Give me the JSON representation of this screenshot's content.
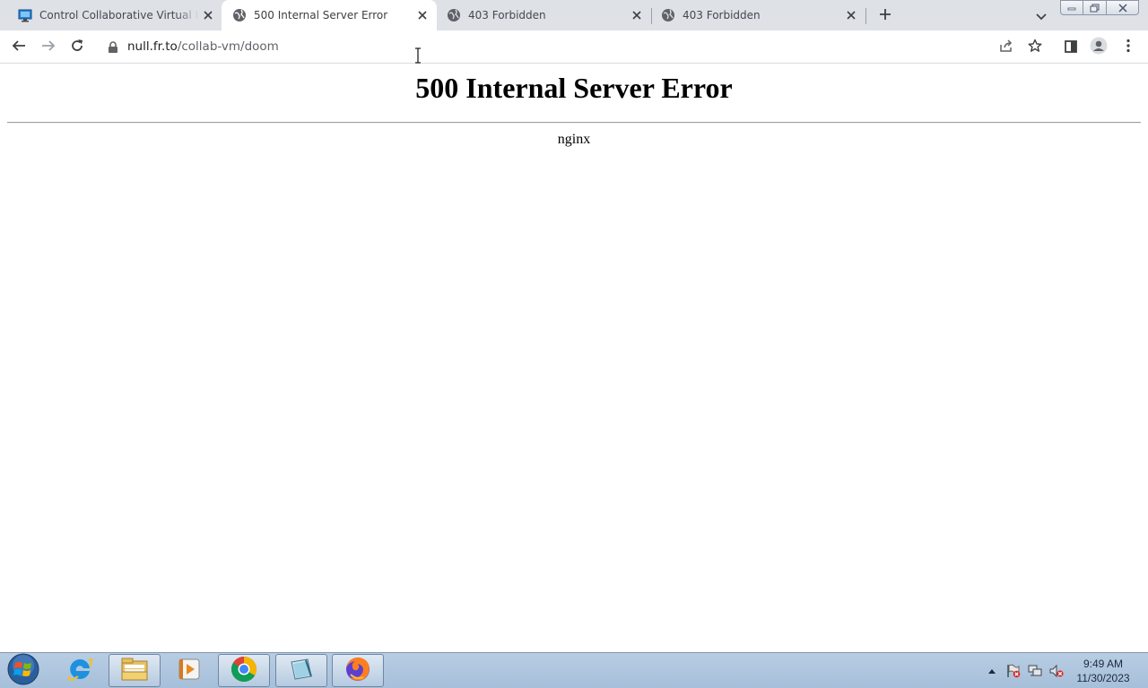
{
  "browser": {
    "tabs": [
      {
        "title": "Control Collaborative Virtual Machines",
        "icon": "monitor-icon",
        "active": false
      },
      {
        "title": "500 Internal Server Error",
        "icon": "globe-icon",
        "active": true
      },
      {
        "title": "403 Forbidden",
        "icon": "globe-icon",
        "active": false
      },
      {
        "title": "403 Forbidden",
        "icon": "globe-icon",
        "active": false
      }
    ],
    "address_bar": {
      "host": "null.fr.to",
      "path": "/collab-vm/doom"
    }
  },
  "page": {
    "heading": "500 Internal Server Error",
    "server": "nginx"
  },
  "taskbar": {
    "apps": [
      "internet-explorer",
      "file-explorer",
      "media-player",
      "chrome",
      "notepad",
      "firefox"
    ],
    "clock_time": "9:49 AM",
    "clock_date": "11/30/2023"
  },
  "colors": {
    "tabstrip": "#dee1e6",
    "taskbar": "#a6bfda"
  }
}
